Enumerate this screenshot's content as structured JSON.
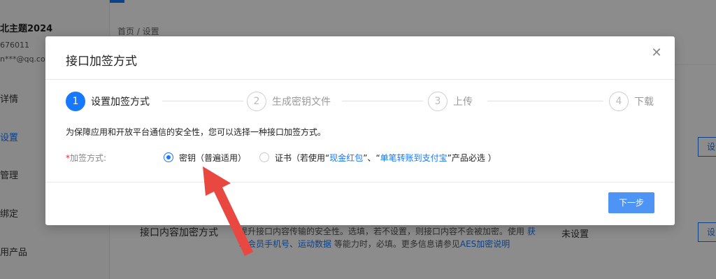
{
  "background": {
    "account_name": "北主题2024",
    "account_id": "676011",
    "account_email": "n***@qq.com",
    "nav_items": [
      {
        "label": "详情",
        "active": false
      },
      {
        "label": "设置",
        "active": true
      },
      {
        "label": "管理",
        "active": false
      },
      {
        "label": "绑定",
        "active": false
      },
      {
        "label": "用产品",
        "active": false
      }
    ],
    "breadcrumb": "首页 / 设置",
    "row_title": "接口内容加密方式",
    "row_desc_prefix": "提升接口内容传输的安全性。选填，若不设置，则接口内容不会被加密。使用",
    "row_desc_link1": "获取会员手机号",
    "row_desc_sep": "、",
    "row_desc_link2": "运动数据",
    "row_desc_mid": " 等能力时，必填。更多信息请参见",
    "row_desc_link3": "AES加密说明",
    "row_status": "未设置",
    "side_button_label": "设"
  },
  "modal": {
    "title": "接口加签方式",
    "close_icon": "close-icon",
    "steps": [
      {
        "num": "1",
        "label": "设置加签方式",
        "active": true
      },
      {
        "num": "2",
        "label": "生成密钥文件",
        "active": false
      },
      {
        "num": "3",
        "label": "上传",
        "active": false
      },
      {
        "num": "4",
        "label": "下载",
        "active": false
      }
    ],
    "description": "为保障应用和开放平台通信的安全性，您可以选择一种接口加签方式。",
    "form": {
      "required_mark": "*",
      "label": "加签方式:",
      "options": [
        {
          "text": "密钥（普遍适用）",
          "checked": true
        },
        {
          "text_prefix": "证书（若使用“",
          "link1": "现金红包",
          "text_mid": "”、“",
          "link2": "单笔转账到支付宝",
          "text_suffix": "”产品必选 ）",
          "checked": false
        }
      ]
    },
    "next_button_label": "下一步"
  },
  "colors": {
    "accent": "#1677ff",
    "annotation_arrow": "#e8483f"
  }
}
